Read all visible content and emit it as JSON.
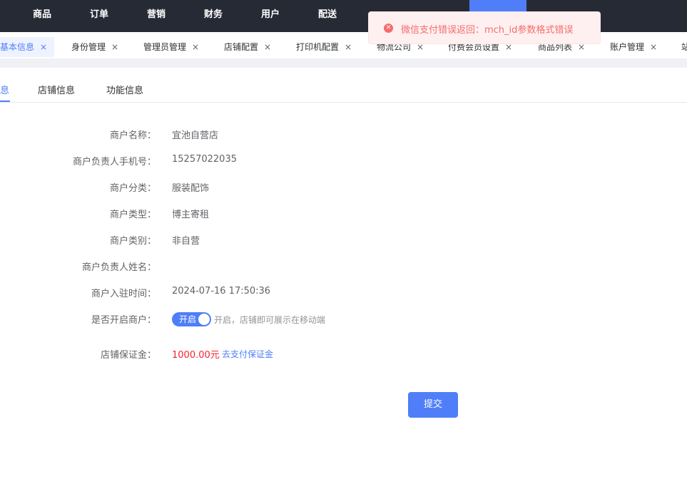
{
  "topnav": {
    "items": [
      "商品",
      "订单",
      "营销",
      "财务",
      "用户",
      "配送"
    ]
  },
  "tabs": [
    {
      "label": "基本信息",
      "active": true
    },
    {
      "label": "身份管理"
    },
    {
      "label": "管理员管理"
    },
    {
      "label": "店铺配置"
    },
    {
      "label": "打印机配置"
    },
    {
      "label": "物流公司"
    },
    {
      "label": "付费会员设置"
    },
    {
      "label": "商品列表"
    },
    {
      "label": "账户管理"
    },
    {
      "label": "站"
    }
  ],
  "tab_close_glyph": "×",
  "subtabs": [
    "息",
    "店铺信息",
    "功能信息"
  ],
  "form": {
    "rows": [
      {
        "label": "商户名称：",
        "value": "宜池自营店"
      },
      {
        "label": "商户负责人手机号：",
        "value": "15257022035"
      },
      {
        "label": "商户分类：",
        "value": "服装配饰"
      },
      {
        "label": "商户类型：",
        "value": "博主寄租"
      },
      {
        "label": "商户类别：",
        "value": "非自营"
      },
      {
        "label": "商户负责人姓名：",
        "value": ""
      },
      {
        "label": "商户入驻时间：",
        "value": "2024-07-16 17:50:36"
      }
    ],
    "open_label": "是否开启商户：",
    "switch_text": "开启",
    "switch_on": true,
    "switch_hint": "开启，店铺即可展示在移动端",
    "deposit_label": "店铺保证金：",
    "deposit_amount": "1000.00元",
    "deposit_link": "去支付保证金",
    "submit": "提交"
  },
  "toast": {
    "type": "error",
    "icon": "error-circle-icon",
    "message": "微信支付错误返回：mch_id参数格式错误"
  },
  "colors": {
    "accent": "#4f7ef8",
    "nav_bg": "#262a35",
    "error": "#f56c6c",
    "amount": "#f5222d"
  }
}
